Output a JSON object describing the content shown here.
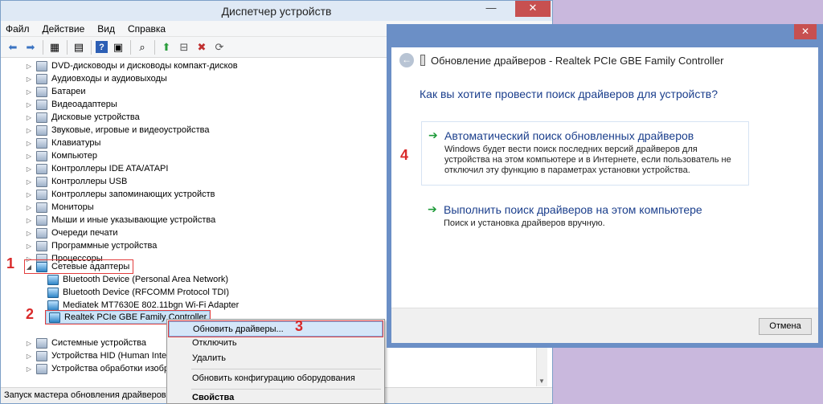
{
  "device_manager": {
    "title": "Диспетчер устройств",
    "minimize": "—",
    "close": "✕",
    "menu": [
      "Файл",
      "Действие",
      "Вид",
      "Справка"
    ],
    "tree": [
      "DVD-дисководы и дисководы компакт-дисков",
      "Аудиовходы и аудиовыходы",
      "Батареи",
      "Видеоадаптеры",
      "Дисковые устройства",
      "Звуковые, игровые и видеоустройства",
      "Клавиатуры",
      "Компьютер",
      "Контроллеры IDE ATA/ATAPI",
      "Контроллеры USB",
      "Контроллеры запоминающих устройств",
      "Мониторы",
      "Мыши и иные указывающие устройства",
      "Очереди печати",
      "Программные устройства",
      "Процессоры",
      "Сетевые адаптеры"
    ],
    "network_children": [
      "Bluetooth Device (Personal Area Network)",
      "Bluetooth Device (RFCOMM Protocol TDI)",
      "Mediatek MT7630E 802.11bgn Wi-Fi Adapter",
      "Realtek PCIe GBE Family Controller"
    ],
    "tree_after": [
      "Системные устройства",
      "Устройства HID (Human Interfa",
      "Устройства обработки изобраз"
    ],
    "status": "Запуск мастера обновления драйверов для"
  },
  "context_menu": {
    "update": "Обновить драйверы...",
    "disable": "Отключить",
    "delete": "Удалить",
    "scan": "Обновить конфигурацию оборудования",
    "properties": "Свойства"
  },
  "dialog": {
    "close": "✕",
    "back": "←",
    "title": "Обновление драйверов - Realtek PCIe GBE Family Controller",
    "question": "Как вы хотите провести поиск драйверов для устройств?",
    "option1_title": "Автоматический поиск обновленных драйверов",
    "option1_desc": "Windows будет вести поиск последних версий драйверов для устройства на этом компьютере и в Интернете, если пользователь не отключил эту функцию в параметрах установки устройства.",
    "option2_title": "Выполнить поиск драйверов на этом компьютере",
    "option2_desc": "Поиск и установка драйверов вручную.",
    "arrow": "➔",
    "cancel": "Отмена"
  },
  "annotations": [
    "1",
    "2",
    "3",
    "4"
  ],
  "colors": {
    "annotation": "#d92a2a",
    "link": "#1a3e8c",
    "arrow": "#1f9b3a",
    "close": "#c75050"
  }
}
